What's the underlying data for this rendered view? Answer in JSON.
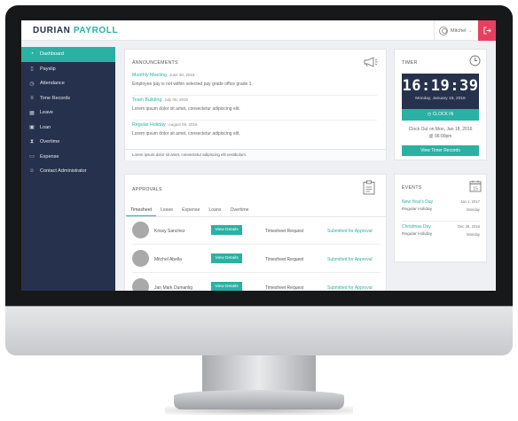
{
  "app": {
    "logo_part1": "DURIAN ",
    "logo_part2": "PAYROLL",
    "user_name": "Mitchel",
    "accent_color": "#2ab1a3",
    "sidebar_color": "#26324d",
    "logout_color": "#e6405f"
  },
  "sidebar": {
    "items": [
      {
        "label": "Dashboard",
        "icon": "dashboard-icon",
        "glyph": "◔"
      },
      {
        "label": "Payslip",
        "icon": "document-icon",
        "glyph": "▯"
      },
      {
        "label": "Attendance",
        "icon": "clock-icon",
        "glyph": "◷"
      },
      {
        "label": "Time Records",
        "icon": "list-icon",
        "glyph": "≡"
      },
      {
        "label": "Leave",
        "icon": "calendar-icon",
        "glyph": "▦"
      },
      {
        "label": "Loan",
        "icon": "money-icon",
        "glyph": "▣"
      },
      {
        "label": "Overtime",
        "icon": "hourglass-icon",
        "glyph": "⧗"
      },
      {
        "label": "Expense",
        "icon": "credit-card-icon",
        "glyph": "▭"
      },
      {
        "label": "Contact Administrator",
        "icon": "user-icon",
        "glyph": "☺"
      }
    ]
  },
  "announcements": {
    "title": "ANNOUNCEMENTS",
    "items": [
      {
        "title": "Monthly Meeting",
        "date": "June 30, 2016",
        "text": "Employee pay is not within selected pay grade office grade 1."
      },
      {
        "title": "Team Building",
        "date": "July 05, 2016",
        "text": "Lorem ipsum dolor sit amet, consectetur adipiscing elit."
      },
      {
        "title": "Regular Holiday",
        "date": "August 09, 2016",
        "text": "Lorem ipsum dolor sit amet, consectetur adipiscing elit."
      }
    ],
    "footer": "Lorem ipsum dolor sit amet, consectetur adipiscing elit vestibulum."
  },
  "timer": {
    "title": "TIMER",
    "time": "16:19:39",
    "date": "Monday, January 18, 2016",
    "clock_in_label": "CLOCK IN",
    "clock_out_line1": "Clock Out on Mon, Jan 18, 2016",
    "clock_out_line2": "@ 06:00pm",
    "view_records_label": "View Timer Records"
  },
  "approvals": {
    "title": "APPROVALS",
    "tabs": [
      "Timesheet",
      "Leave",
      "Expense",
      "Loans",
      "Overtime"
    ],
    "rows": [
      {
        "name": "Krissy Sanchez",
        "button": "View Details",
        "type": "Timesheet Request",
        "status": "Submitted for Approval"
      },
      {
        "name": "Mitchel Abella",
        "button": "View Details",
        "type": "Timesheet Request",
        "status": "Submitted for Approval"
      },
      {
        "name": "Jan Mark Dumanlig",
        "button": "View Details",
        "type": "Timesheet Request",
        "status": "Submitted for Approval"
      }
    ]
  },
  "events": {
    "title": "EVENTS",
    "calendar_day": "15",
    "items": [
      {
        "title": "New Year's Day",
        "sub": "Regular Holiday",
        "date": "Jan 1, 2017",
        "day": "Monday"
      },
      {
        "title": "Christmas Day",
        "sub": "Regular Holiday",
        "date": "Dec 25, 2016",
        "day": "Monday"
      }
    ]
  }
}
